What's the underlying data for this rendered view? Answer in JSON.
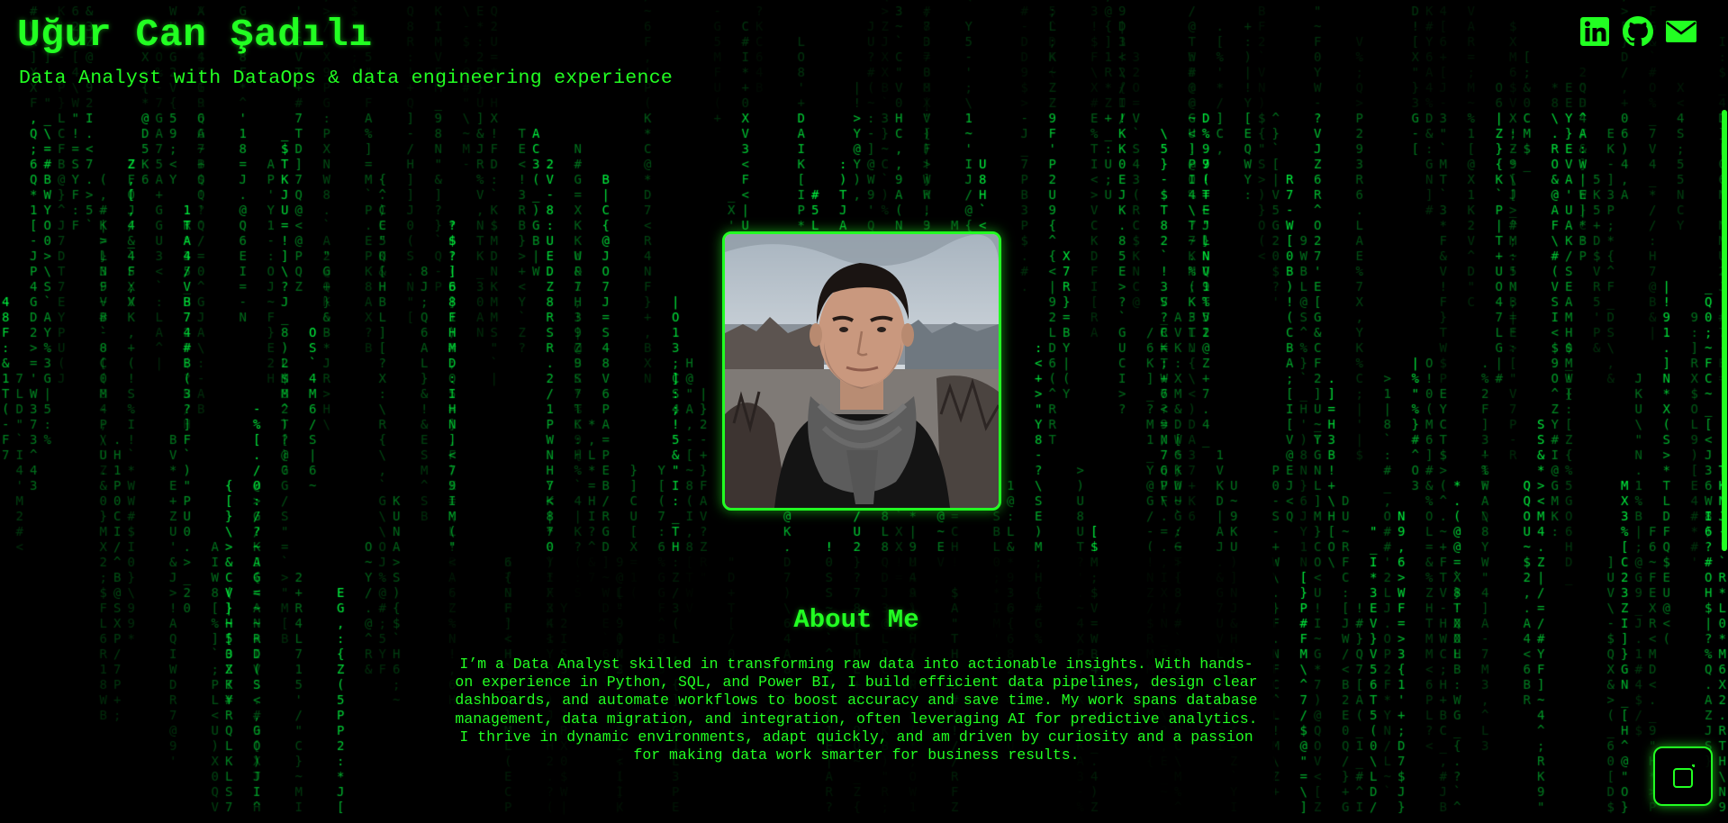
{
  "header": {
    "name": "Uğur Can Şadılı",
    "tagline": "Data Analyst with DataOps & data engineering experience"
  },
  "social": [
    {
      "name": "linkedin",
      "icon": "linkedin-icon"
    },
    {
      "name": "github",
      "icon": "github-icon"
    },
    {
      "name": "email",
      "icon": "mail-icon"
    }
  ],
  "profile": {
    "photo_alt": "Profile photo"
  },
  "about": {
    "title": "About Me",
    "body": "I’m a Data Analyst skilled in transforming raw data into actionable insights. With hands-on experience in Python, SQL, and Power BI, I build efficient data pipelines, design clear dashboards, and automate workflows to boost accuracy and save time. My work spans database management, data migration, and integration, often leveraging AI for predictive analytics. I thrive in dynamic environments, adapt quickly, and am driven by curiosity and a passion for making data work smarter for business results."
  },
  "floating_button": {
    "icon": "window-icon"
  },
  "colors": {
    "accent": "#22ff22",
    "background": "#000000"
  }
}
